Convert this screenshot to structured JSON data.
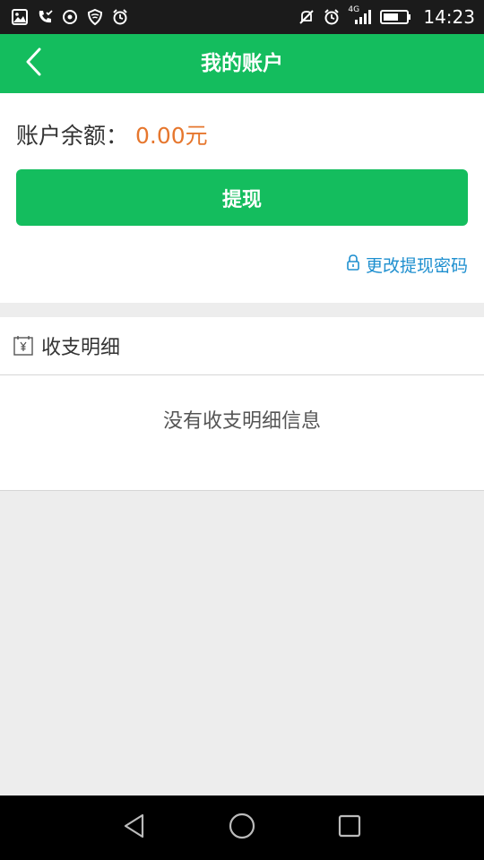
{
  "status_bar": {
    "time": "14:23",
    "network_label": "4G",
    "left_icons": [
      "gallery-icon",
      "phone-check-icon",
      "target-icon",
      "shield-icon",
      "alarm-icon"
    ],
    "right_icons": [
      "mute-icon",
      "alarm-icon",
      "signal-icon",
      "battery-icon"
    ]
  },
  "app_bar": {
    "title": "我的账户",
    "back_icon": "chevron-left-icon"
  },
  "account": {
    "balance_label": "账户余额：",
    "balance_value": "0.00元",
    "withdraw_label": "提现",
    "change_password_label": "更改提现密码"
  },
  "details": {
    "title": "收支明细",
    "empty_message": "没有收支明细信息"
  },
  "colors": {
    "brand_green": "#14bd5e",
    "balance_orange": "#e6772e",
    "link_blue": "#1e8fcf"
  },
  "nav_bar": {
    "buttons": [
      "back-triangle-icon",
      "home-circle-icon",
      "recents-square-icon"
    ]
  }
}
